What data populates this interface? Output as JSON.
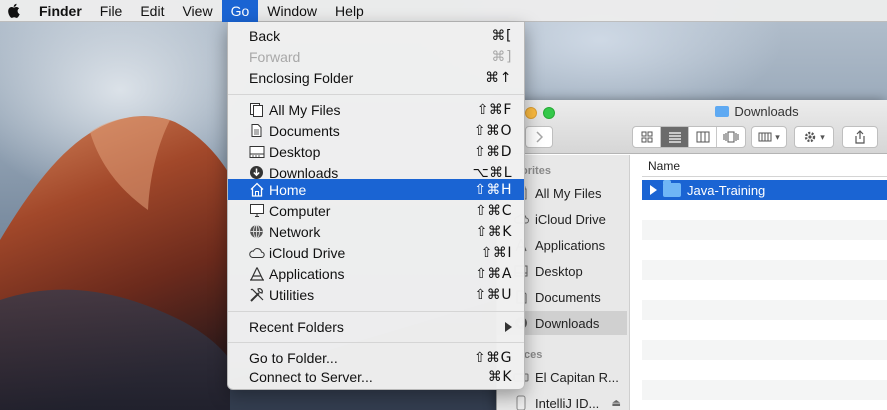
{
  "menubar": {
    "apple_icon": "apple-logo-icon",
    "app_name": "Finder",
    "items": [
      "File",
      "Edit",
      "View",
      "Go",
      "Window",
      "Help"
    ],
    "active": "Go"
  },
  "go_menu": {
    "items": [
      {
        "label": "Back",
        "shortcut": "⌘[",
        "enabled": true
      },
      {
        "label": "Forward",
        "shortcut": "⌘]",
        "enabled": false
      },
      {
        "label": "Enclosing Folder",
        "shortcut": "⌘↑",
        "enabled": true
      },
      {
        "label": "All My Files",
        "shortcut": "⇧⌘F",
        "icon": "all-my-files-icon"
      },
      {
        "label": "Documents",
        "shortcut": "⇧⌘O",
        "icon": "documents-icon"
      },
      {
        "label": "Desktop",
        "shortcut": "⇧⌘D",
        "icon": "desktop-icon"
      },
      {
        "label": "Downloads",
        "shortcut": "⌥⌘L",
        "icon": "downloads-icon"
      },
      {
        "label": "Home",
        "shortcut": "⇧⌘H",
        "icon": "home-icon",
        "highlighted": true
      },
      {
        "label": "Computer",
        "shortcut": "⇧⌘C",
        "icon": "computer-icon"
      },
      {
        "label": "Network",
        "shortcut": "⇧⌘K",
        "icon": "network-icon"
      },
      {
        "label": "iCloud Drive",
        "shortcut": "⇧⌘I",
        "icon": "icloud-icon"
      },
      {
        "label": "Applications",
        "shortcut": "⇧⌘A",
        "icon": "applications-icon"
      },
      {
        "label": "Utilities",
        "shortcut": "⇧⌘U",
        "icon": "utilities-icon"
      },
      {
        "label": "Recent Folders",
        "submenu": true
      },
      {
        "label": "Go to Folder...",
        "shortcut": "⇧⌘G"
      },
      {
        "label": "Connect to Server...",
        "shortcut": "⌘K"
      }
    ]
  },
  "finder_window": {
    "title": "Downloads",
    "sidebar": {
      "favorites_header": "orites",
      "devices_header": "ices",
      "items": [
        "All My Files",
        "iCloud Drive",
        "Applications",
        "Desktop",
        "Documents",
        "Downloads"
      ],
      "selected": "Downloads",
      "devices": [
        "El Capitan R...",
        "IntelliJ ID..."
      ]
    },
    "column_header": "Name",
    "files": [
      {
        "name": "Java-Training",
        "kind": "folder",
        "selected": true
      }
    ]
  },
  "colors": {
    "accent": "#1a64d3",
    "folder": "#6fb6f6"
  }
}
